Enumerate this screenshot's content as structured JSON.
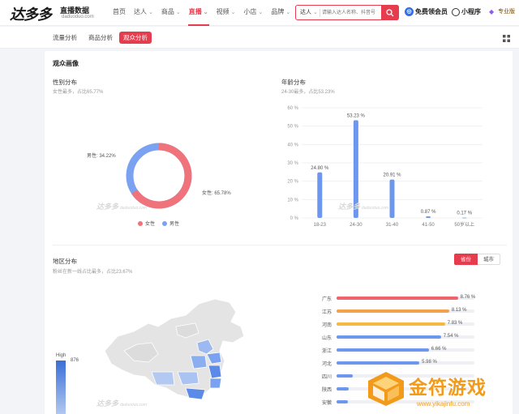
{
  "header": {
    "brand": "达多多",
    "brand_sub": "直播数据",
    "domain": "daduoduo.com",
    "nav": [
      {
        "label": "首页",
        "caret": false,
        "active": false
      },
      {
        "label": "达人",
        "caret": true,
        "active": false
      },
      {
        "label": "商品",
        "caret": true,
        "active": false
      },
      {
        "label": "直播",
        "caret": true,
        "active": true
      },
      {
        "label": "视频",
        "caret": true,
        "active": false
      },
      {
        "label": "小店",
        "caret": true,
        "active": false
      },
      {
        "label": "品牌",
        "caret": true,
        "active": false
      }
    ],
    "search_scope": "达人",
    "search_placeholder": "请输入达人名称、抖音号",
    "vip_label": "免费领会员",
    "mini_label": "小程序",
    "pro_label": "专业版"
  },
  "subtabs": [
    "流量分析",
    "商品分析",
    "观众分析"
  ],
  "active_subtab": 2,
  "audience": {
    "title": "观众画像",
    "gender": {
      "title": "性别分布",
      "summary": "女性最多，占比65.77%",
      "female_label": "女性: 65.78%",
      "male_label": "男性: 34.22%",
      "legend_female": "女性",
      "legend_male": "男性",
      "female_color": "#f0727a",
      "male_color": "#7aa2f0"
    },
    "age": {
      "title": "年龄分布",
      "summary": "24-30最多，占比53.23%"
    },
    "watermark": "达多多",
    "watermark_sub": "daduoduo.com"
  },
  "chart_data": {
    "type": "bar",
    "title": "年龄分布",
    "categories": [
      "18-23",
      "24-30",
      "31-40",
      "41-50",
      "50岁以上"
    ],
    "values": [
      24.8,
      53.23,
      20.91,
      0.87,
      0.17
    ],
    "value_labels": [
      "24.80 %",
      "53.23 %",
      "20.91 %",
      "0.87 %",
      "0.17 %"
    ],
    "ylim": [
      0,
      60
    ],
    "yticks": [
      "0 %",
      "10 %",
      "20 %",
      "30 %",
      "40 %",
      "50 %",
      "60 %"
    ],
    "grid": true,
    "bar_color": "#6d97ee"
  },
  "region": {
    "title": "地区分布",
    "summary": "粉丝在新一线占比最多，占比23.67%",
    "toggle_province": "省份",
    "toggle_city": "城市",
    "scale_high": "High",
    "scale_value": "876",
    "provinces": [
      {
        "name": "广东",
        "value": 8.76,
        "label": "8.76 %",
        "color": "#f0646e"
      },
      {
        "name": "江苏",
        "value": 8.13,
        "label": "8.13 %",
        "color": "#f3a24a"
      },
      {
        "name": "河南",
        "value": 7.83,
        "label": "7.83 %",
        "color": "#f5b942"
      },
      {
        "name": "山东",
        "value": 7.54,
        "label": "7.54 %",
        "color": "#6d97ee"
      },
      {
        "name": "浙江",
        "value": 6.66,
        "label": "6.66 %",
        "color": "#6d97ee"
      },
      {
        "name": "河北",
        "value": 5.98,
        "label": "5.98 %",
        "color": "#6d97ee"
      },
      {
        "name": "四川",
        "value": 1.2,
        "label": "",
        "color": "#6d97ee"
      },
      {
        "name": "陕西",
        "value": 0.9,
        "label": "",
        "color": "#6d97ee"
      },
      {
        "name": "安徽",
        "value": 0.8,
        "label": "",
        "color": "#6d97ee"
      }
    ]
  },
  "overlay": {
    "site_name": "金符游戏",
    "site_url": "www.yikajinfu.com"
  }
}
